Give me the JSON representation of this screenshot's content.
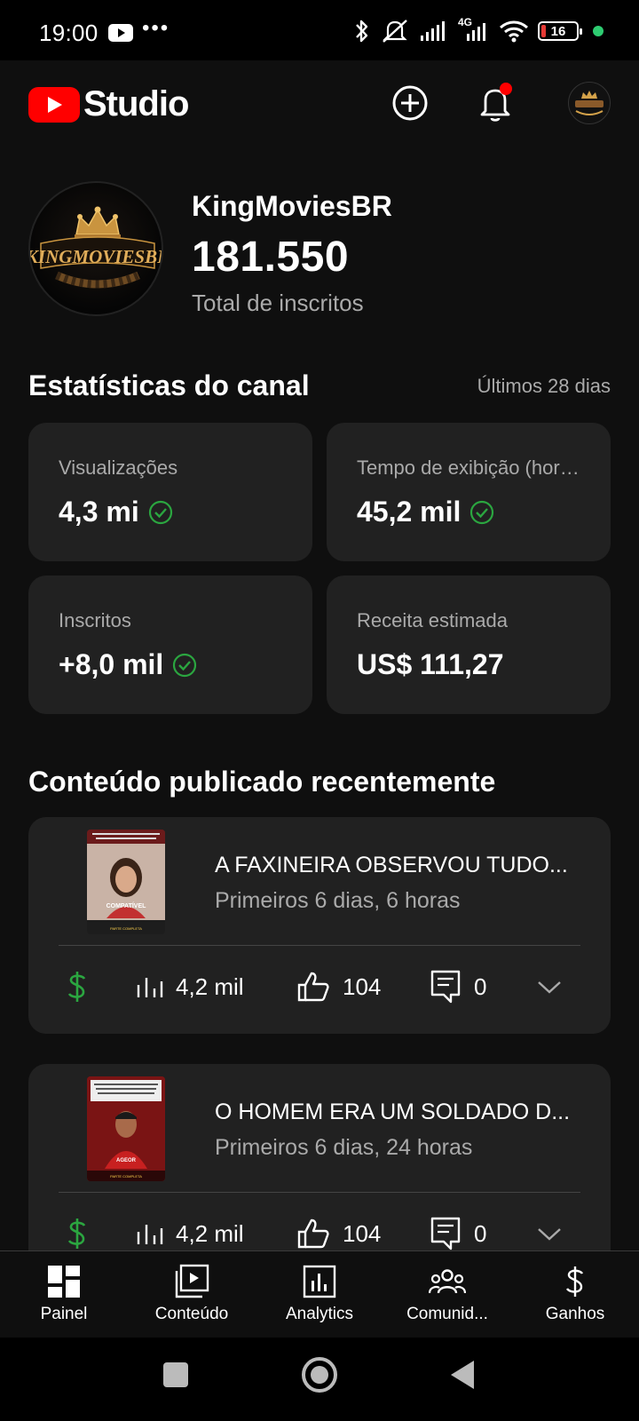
{
  "status_bar": {
    "time": "19:00",
    "dots": "•••",
    "network": "4G",
    "battery": "16"
  },
  "app_header": {
    "logo_text": "Studio",
    "create_icon": "plus-circle-icon",
    "notifications_icon": "bell-icon",
    "notification_dot_color": "#ff0000",
    "account_icon": "avatar"
  },
  "channel": {
    "name": "KingMoviesBR",
    "subscribers": "181.550",
    "subscribers_label": "Total de inscritos",
    "avatar_text": "KINGMOVIESBR"
  },
  "stats": {
    "title": "Estatísticas do canal",
    "period": "Últimos 28 dias",
    "cards": [
      {
        "label": "Visualizações",
        "value": "4,3 mi",
        "check": true
      },
      {
        "label": "Tempo de exibição (horas)",
        "value": "45,2 mil",
        "check": true
      },
      {
        "label": "Inscritos",
        "value": "+8,0 mil",
        "check": true
      },
      {
        "label": "Receita estimada",
        "value": "US$ 111,27",
        "check": false
      }
    ]
  },
  "recent": {
    "title": "Conteúdo publicado recentemente",
    "videos": [
      {
        "title": "A FAXINEIRA OBSERVOU TUDO...",
        "subtitle": "Primeiros 6 dias, 6 horas",
        "views": "4,2 mil",
        "likes": "104",
        "comments": "0",
        "thumb_caption": "COMPATÍVEL",
        "thumb_footer": "PARTE COMPLETA"
      },
      {
        "title": "O HOMEM ERA UM SOLDADO D...",
        "subtitle": "Primeiros 6 dias, 24 horas",
        "views": "4,2 mil",
        "likes": "104",
        "comments": "0",
        "thumb_caption": "AGEOR",
        "thumb_footer": "PARTE COMPLETA"
      }
    ]
  },
  "bottom_nav": {
    "items": [
      {
        "label": "Painel",
        "icon": "dashboard-icon"
      },
      {
        "label": "Conteúdo",
        "icon": "content-icon"
      },
      {
        "label": "Analytics",
        "icon": "analytics-icon"
      },
      {
        "label": "Comunid...",
        "icon": "community-icon"
      },
      {
        "label": "Ganhos",
        "icon": "dollar-icon"
      }
    ]
  },
  "colors": {
    "brand_red": "#ff0000",
    "monetization_green": "#2ba640",
    "check_green": "#2ba640",
    "card_bg": "#212121",
    "page_bg": "#0f0f0f"
  }
}
